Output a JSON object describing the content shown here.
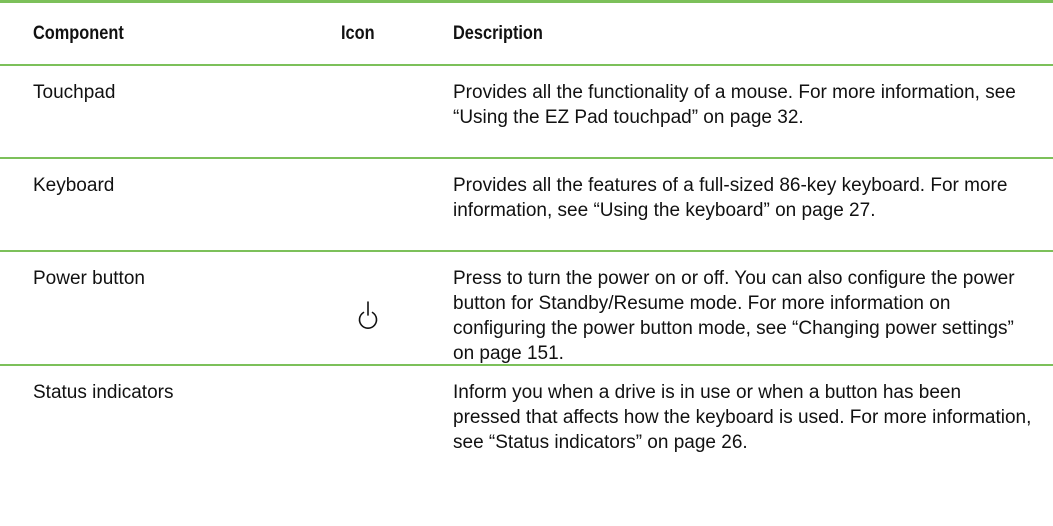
{
  "table": {
    "headers": {
      "component": "Component",
      "icon": "Icon",
      "description": "Description"
    },
    "rows": [
      {
        "component": "Touchpad",
        "icon": "",
        "description": "Provides all the functionality of a mouse. For more information, see “Using the EZ Pad touchpad” on page 32."
      },
      {
        "component": "Keyboard",
        "icon": "",
        "description": "Provides all the features of a full-sized 86-key keyboard. For more information, see “Using the keyboard” on page 27."
      },
      {
        "component": "Power button",
        "icon": "power-icon",
        "description": "Press to turn the power on or off. You can also configure the power button for Standby/Resume mode. For more information on configuring the power button mode, see “Changing power settings” on page 151."
      },
      {
        "component": "Status indicators",
        "icon": "",
        "description": "Inform you when a drive is in use or when a button has been pressed that affects how the keyboard is used. For more information, see “Status indicators” on page 26."
      }
    ]
  },
  "colors": {
    "rule": "#7cc05a",
    "text": "#111111"
  }
}
